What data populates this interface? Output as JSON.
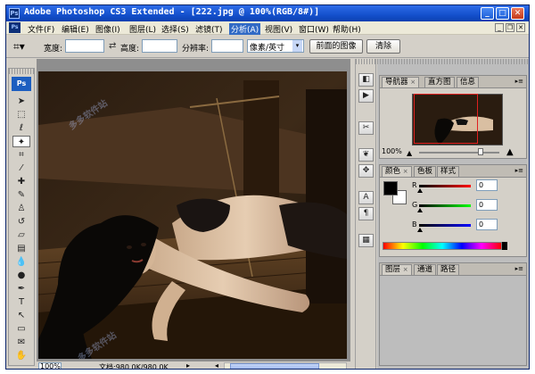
{
  "window": {
    "title": "Adobe Photoshop CS3 Extended - [222.jpg @ 100%(RGB/8#)]",
    "app_badge": "Ps",
    "controls": {
      "minimize": "_",
      "maximize": "□",
      "close": "✕"
    }
  },
  "menubar": {
    "items": [
      {
        "label": "文件(F)"
      },
      {
        "label": "编辑(E)"
      },
      {
        "label": "图像(I)"
      },
      {
        "label": "图层(L)"
      },
      {
        "label": "选择(S)"
      },
      {
        "label": "滤镜(T)"
      },
      {
        "label": "分析(A)"
      },
      {
        "label": "视图(V)"
      },
      {
        "label": "窗口(W)"
      },
      {
        "label": "帮助(H)"
      }
    ],
    "active_index": 6,
    "doc_controls": {
      "minimize": "_",
      "restore": "❐",
      "close": "✕"
    }
  },
  "options_bar": {
    "tool_icon": "crop-icon",
    "width_label": "宽度:",
    "width_value": "",
    "height_label": "高度:",
    "height_value": "",
    "resolution_label": "分辨率:",
    "resolution_value": "",
    "unit_select": "像素/英寸",
    "front_image_button": "前面的图像",
    "clear_button": "清除"
  },
  "tools": {
    "logo": "Ps",
    "selected_index": 3,
    "items": [
      {
        "icon": "move-icon",
        "glyph": "➤"
      },
      {
        "icon": "marquee-icon",
        "glyph": "⬚"
      },
      {
        "icon": "lasso-icon",
        "glyph": "ℓ"
      },
      {
        "icon": "magic-wand-icon",
        "glyph": "✦"
      },
      {
        "icon": "crop-icon",
        "glyph": "⌗"
      },
      {
        "icon": "eyedropper-icon",
        "glyph": "⁄"
      },
      {
        "icon": "healing-brush-icon",
        "glyph": "✚"
      },
      {
        "icon": "brush-icon",
        "glyph": "✎"
      },
      {
        "icon": "clone-stamp-icon",
        "glyph": "♙"
      },
      {
        "icon": "history-brush-icon",
        "glyph": "↺"
      },
      {
        "icon": "eraser-icon",
        "glyph": "▱"
      },
      {
        "icon": "gradient-icon",
        "glyph": "▤"
      },
      {
        "icon": "blur-icon",
        "glyph": "💧"
      },
      {
        "icon": "dodge-icon",
        "glyph": "●"
      },
      {
        "icon": "pen-icon",
        "glyph": "✒"
      },
      {
        "icon": "type-icon",
        "glyph": "T"
      },
      {
        "icon": "path-selection-icon",
        "glyph": "↖"
      },
      {
        "icon": "shape-icon",
        "glyph": "▭"
      },
      {
        "icon": "notes-icon",
        "glyph": "✉"
      },
      {
        "icon": "hand-icon",
        "glyph": "✋"
      }
    ]
  },
  "document": {
    "zoom": "100%",
    "doc_info": "文档:980.0K/980.0K",
    "status_arrow_left": "◂",
    "status_arrow_right": "▸"
  },
  "dock": {
    "icons": [
      "navigator-dock-icon",
      "history-dock-icon",
      "tool-presets-dock-icon",
      "brushes-dock-icon",
      "clone-source-dock-icon",
      "character-dock-icon",
      "paragraph-dock-icon",
      "layer-comps-dock-icon"
    ],
    "glyphs": [
      "◧",
      "▶",
      "✂",
      "❦",
      "✥",
      "A",
      "¶",
      "▦"
    ]
  },
  "panels": {
    "navigator": {
      "tabs": [
        "导航器",
        "直方图",
        "信息"
      ],
      "active_tab": 0,
      "zoom": "100%"
    },
    "color": {
      "tabs": [
        "颜色",
        "色板",
        "样式"
      ],
      "active_tab": 0,
      "labels": [
        "R",
        "G",
        "B"
      ],
      "values": [
        "0",
        "0",
        "0"
      ],
      "foreground": "#000000",
      "background": "#ffffff"
    },
    "layers": {
      "tabs": [
        "图层",
        "通道",
        "路径"
      ],
      "active_tab": 0
    }
  },
  "colors": {
    "titlebar": "#1450cc",
    "menu_active": "#316ac5",
    "workspace": "#8e8e8e"
  }
}
